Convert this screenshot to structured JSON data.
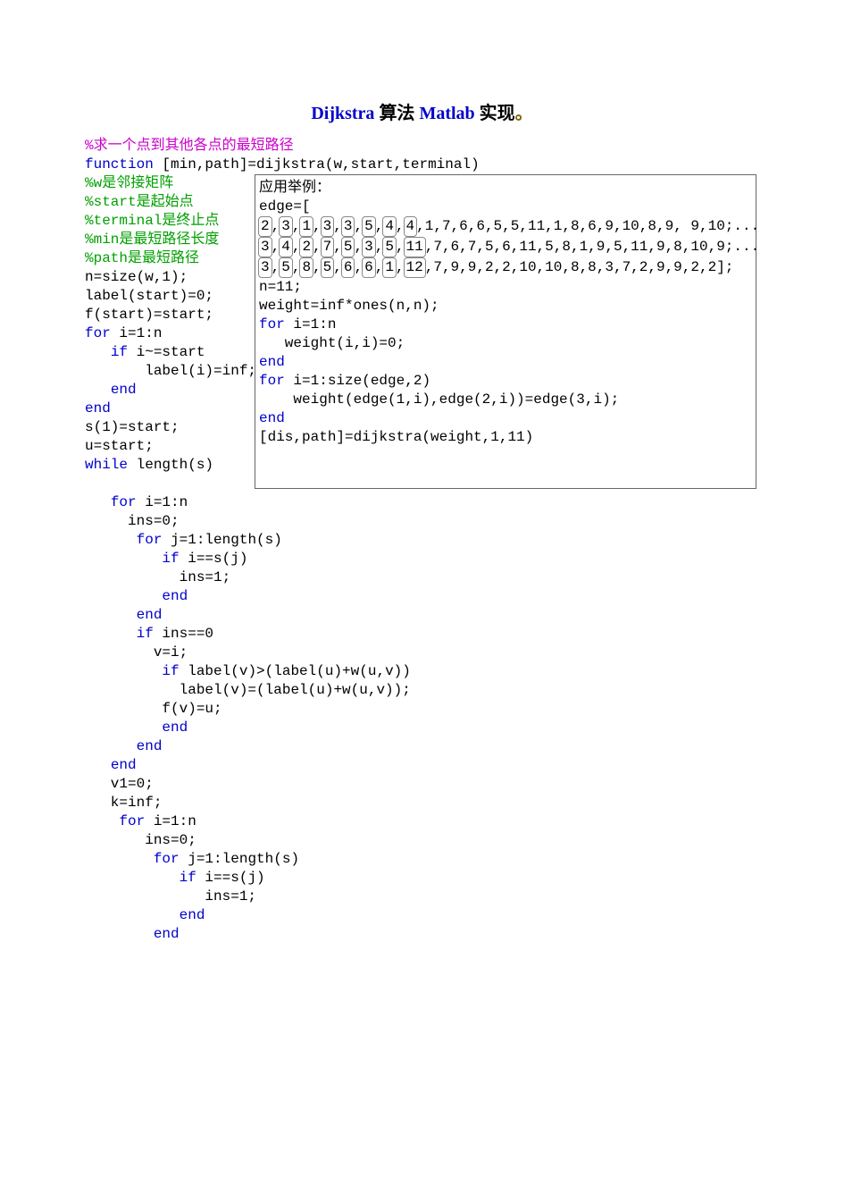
{
  "title_prefix": "Dijkstra",
  "title_mid": "算法",
  "title_suffix": "Matlab",
  "title_end": "实现",
  "title_period": "。",
  "comment1": "%求一个点到其他各点的最短路径",
  "func_kw": "function",
  "func_sig": " [min,path]=dijkstra(w,start,terminal)",
  "c2": "%w是邻接矩阵",
  "c3": "%start是起始点",
  "c4": "%terminal是终止点",
  "c5": "%min是最短路径长度",
  "c6": "%path是最短路径",
  "l7": "n=size(w,1);",
  "l8": "label(start)=0;",
  "l9": "f(start)=start;",
  "kw_for": "for",
  "kw_if": "if",
  "kw_end": "end",
  "kw_while": "while",
  "l10b": " i=1:n",
  "l11b": " i~=start",
  "l12": "       label(i)=inf;",
  "l15": "s(1)=start;",
  "l16": "u=start;",
  "l17b": " length(s)",
  "l18b": " i=1:n",
  "l19": "     ins=0;",
  "l20b": " j=1:length(s)",
  "l21b": " i==s(j)",
  "l22": "           ins=1;",
  "l25b": " ins==0",
  "l26": "        v=i;",
  "l27b": " label(v)>(label(u)+w(u,v))",
  "l28": "           label(v)=(label(u)+w(u,v));",
  "l29": "         f(v)=u;",
  "l33": "   v1=0;",
  "l34": "   k=inf;",
  "l35b": " i=1:n",
  "l36": "       ins=0;",
  "l37b": " j=1:length(s)",
  "l38b": " i==s(j)",
  "l39": "              ins=1;",
  "ex_title": "应用举例：",
  "ex_edge": "edge=[",
  "ex_r1_cells": [
    "2",
    "3",
    "1",
    "3",
    "3",
    "5",
    "4",
    "4"
  ],
  "ex_r1_rest": ",1,7,6,6,5,5,11,1,8,6,9,10,8,9, 9,10;...",
  "ex_r2_cells": [
    "3",
    "4",
    "2",
    "7",
    "5",
    "3",
    "5",
    "11"
  ],
  "ex_r2_rest": ",7,6,7,5,6,11,5,8,1,9,5,11,9,8,10,9;...",
  "ex_r3_cells": [
    "3",
    "5",
    "8",
    "5",
    "6",
    "6",
    "1",
    "12"
  ],
  "ex_r3_rest": ",7,9,9,2,2,10,10,8,8,3,7,2,9,9,2,2];",
  "ex_l3": "n=11;",
  "ex_l4": "weight=inf*ones(n,n);",
  "ex_l5a": "for",
  "ex_l5b": " i=1:n",
  "ex_l6": "   weight(i,i)=0;",
  "ex_l7": "end",
  "ex_l8b": " i=1:size(edge,2)",
  "ex_l9": "    weight(edge(1,i),edge(2,i))=edge(3,i);",
  "ex_l10": "end",
  "ex_l11": "[dis,path]=dijkstra(weight,1,11)"
}
